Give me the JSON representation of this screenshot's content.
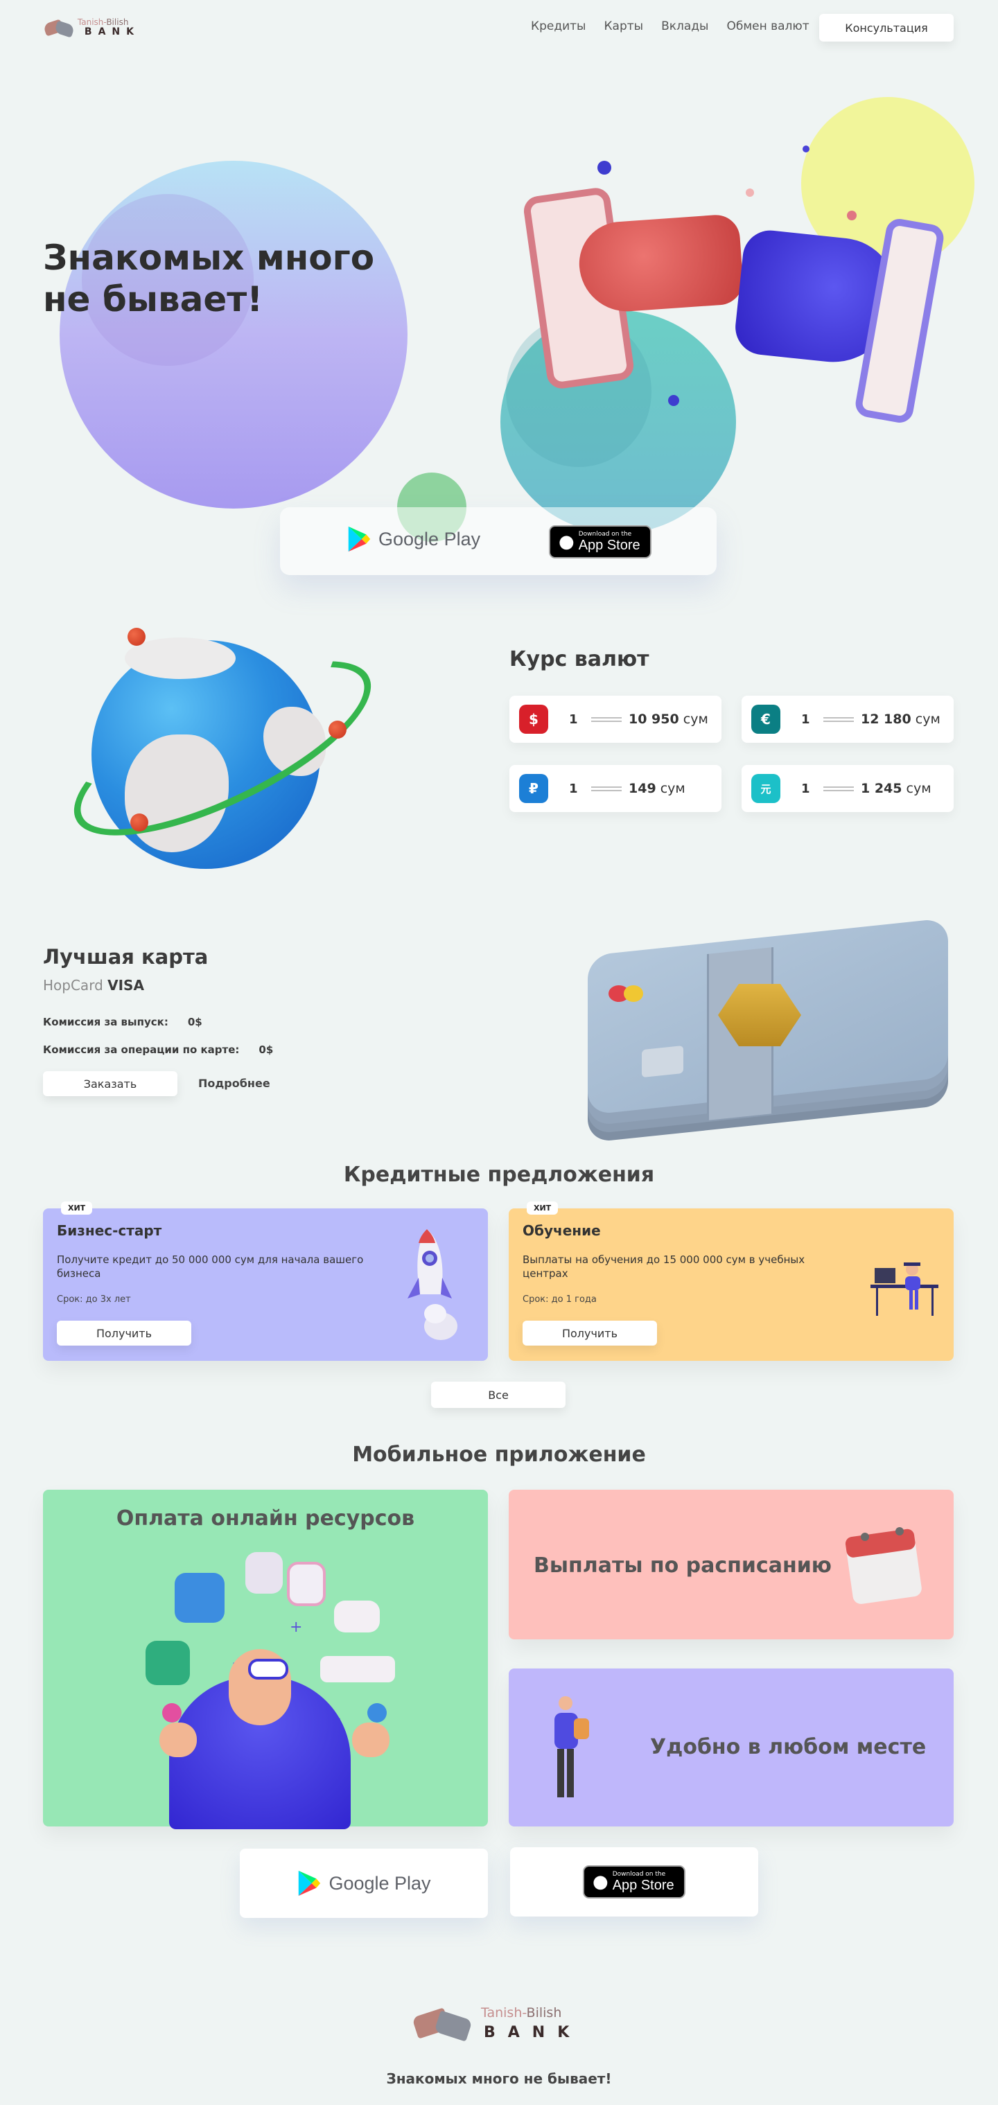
{
  "brand": {
    "name_part1": "Tanish-",
    "name_part2": "Bilish",
    "bank_word": "BANK"
  },
  "nav": {
    "items": [
      "Кредиты",
      "Карты",
      "Вклады",
      "Обмен валют"
    ],
    "consult_button": "Консультация"
  },
  "hero": {
    "title_line1": "Знакомых много",
    "title_line2": "не бывает!"
  },
  "stores": {
    "google_play": "Google Play",
    "app_store_small": "Download on the",
    "app_store_big": "App Store"
  },
  "rates": {
    "title": "Курс валют",
    "currency_unit": "сум",
    "items": [
      {
        "icon": "dollar-icon",
        "symbol": "$",
        "color": "#d8202a",
        "amount": "1",
        "value": "10 950"
      },
      {
        "icon": "euro-icon",
        "symbol": "€",
        "color": "#0b7f84",
        "amount": "1",
        "value": "12 180"
      },
      {
        "icon": "ruble-icon",
        "symbol": "₽",
        "color": "#1c7fd6",
        "amount": "1",
        "value": "149"
      },
      {
        "icon": "yuan-icon",
        "symbol": "元",
        "color": "#1cc0c8",
        "amount": "1",
        "value": "1 245"
      }
    ]
  },
  "best_card": {
    "title": "Лучшая карта",
    "card_brand": "HopCard",
    "card_network": "VISA",
    "issue_fee_label": "Комиссия за выпуск:",
    "issue_fee_value": "0$",
    "ops_fee_label": "Комиссия за операции по карте:",
    "ops_fee_value": "0$",
    "order_button": "Заказать",
    "more_link": "Подробнее"
  },
  "credit": {
    "title": "Кредитные предложения",
    "offers": [
      {
        "badge": "ХИТ",
        "title": "Бизнес-старт",
        "description": "Получите кредит до 50 000 000 сум для начала вашего бизнеса",
        "term": "Срок: до 3х лет",
        "button": "Получить",
        "color": "#b9bbfb"
      },
      {
        "badge": "ХИТ",
        "title": "Обучение",
        "description": "Выплаты на обучения до 15 000 000 сум в учебных центрах",
        "term": "Срок: до 1 года",
        "button": "Получить",
        "color": "#fed48a"
      }
    ],
    "all_button": "Все"
  },
  "mobile": {
    "title": "Мобильное приложение",
    "features": [
      {
        "title": "Оплата онлайн ресурсов",
        "color": "#97e7b5"
      },
      {
        "title": "Выплаты по расписанию",
        "color": "#fec0bc"
      },
      {
        "title": "Удобно в любом месте",
        "color": "#bfb7fb"
      }
    ]
  },
  "footer": {
    "slogan": "Знакомых много не бывает!"
  }
}
